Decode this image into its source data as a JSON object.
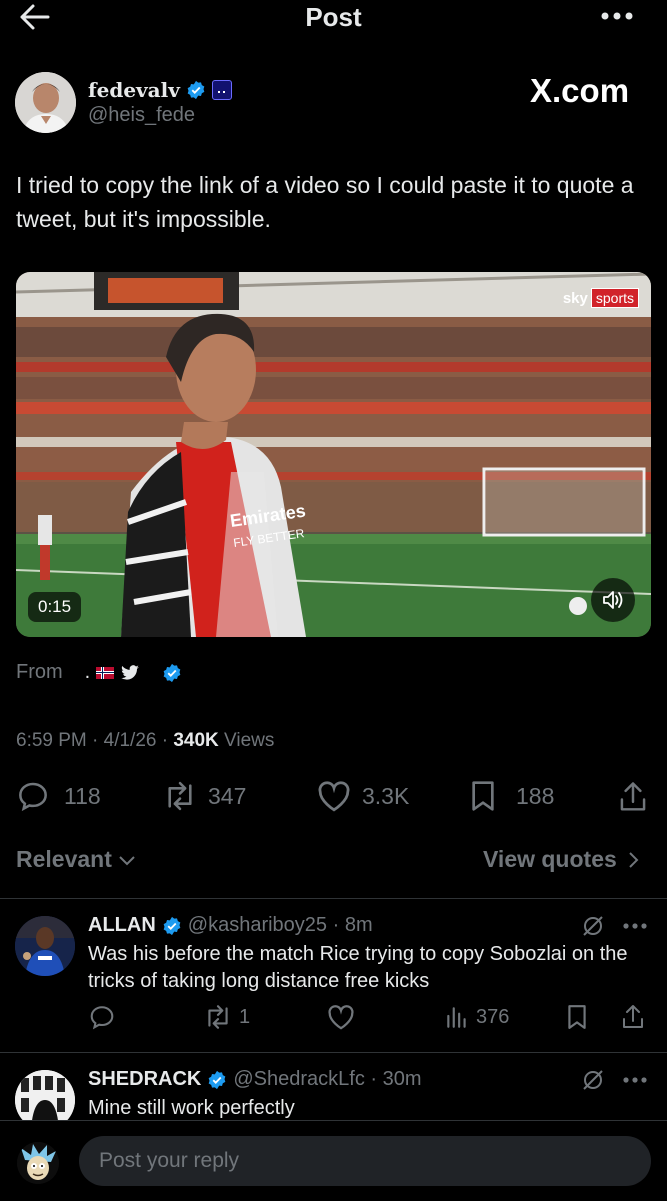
{
  "header": {
    "title": "Post"
  },
  "post": {
    "display_name": "fedevalv",
    "handle": "@heis_fede",
    "watermark": "X.com",
    "text": "I tried to copy the link of a video so I could paste it to quote a tweet, but it's impossible.",
    "video": {
      "duration": "0:15",
      "broadcaster_a": "sky",
      "broadcaster_b": "sports",
      "sponsor_text_1": "Emirates",
      "sponsor_text_2": "FLY BETTER"
    },
    "from_label": "From",
    "from_suffix": ".",
    "meta": {
      "time_date": "6:59 PM · 4/1/26 · ",
      "views_count": "340K",
      "views_label": " Views"
    },
    "stats": {
      "replies": "118",
      "reposts": "347",
      "likes": "3.3K",
      "bookmarks": "188"
    }
  },
  "filter": {
    "sort_label": "Relevant",
    "view_quotes": "View quotes"
  },
  "replies": [
    {
      "name": "ALLAN",
      "handle": "@kashariboy25",
      "time": " · 8m",
      "text": "Was his before the match Rice trying to copy Sobozlai on the tricks of taking long distance free kicks",
      "reposts": "1",
      "views": "376"
    },
    {
      "name": "SHEDRACK",
      "handle": "@ShedrackLfc",
      "time": " · 30m",
      "text": "Mine still work perfectly"
    }
  ],
  "composer": {
    "placeholder": "Post your reply"
  },
  "colors": {
    "accent": "#1d9bf0",
    "background": "#000000",
    "text": "#e7e9ea",
    "muted": "#71767b"
  }
}
